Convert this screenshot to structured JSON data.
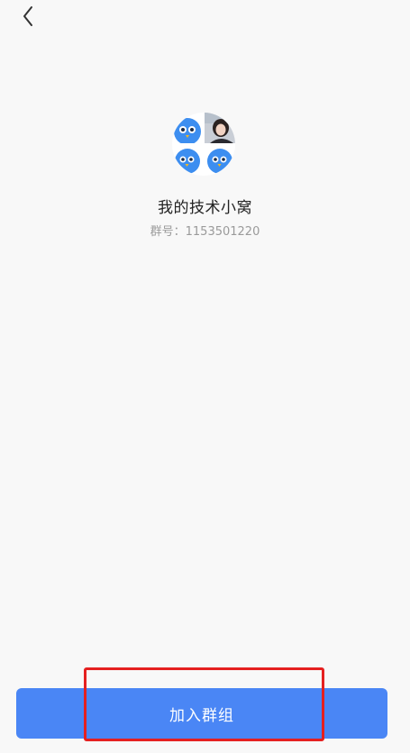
{
  "nav": {
    "back_icon": "chevron-left-icon"
  },
  "group": {
    "avatar_icon": "group-avatar-collage",
    "name": "我的技术小窝",
    "id_text": "群号：1153501220"
  },
  "actions": {
    "join_label": "加入群组"
  },
  "colors": {
    "background": "#f8f8f8",
    "accent": "#4a86f5",
    "annotation": "#e52020"
  }
}
